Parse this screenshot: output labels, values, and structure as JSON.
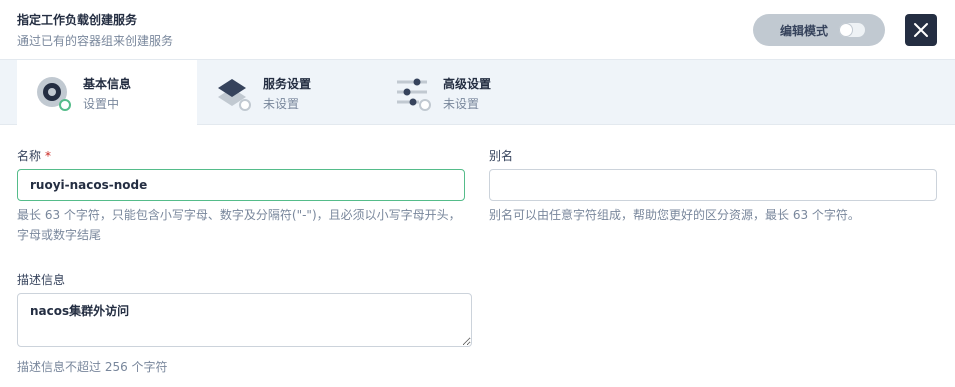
{
  "header": {
    "title": "指定工作负载创建服务",
    "subtitle": "通过已有的容器组来创建服务",
    "edit_mode_label": "编辑模式"
  },
  "tabs": [
    {
      "label": "基本信息",
      "status": "设置中"
    },
    {
      "label": "服务设置",
      "status": "未设置"
    },
    {
      "label": "高级设置",
      "status": "未设置"
    }
  ],
  "form": {
    "name": {
      "label": "名称",
      "required_mark": "*",
      "value": "ruoyi-nacos-node",
      "hint": "最长 63 个字符，只能包含小写字母、数字及分隔符(\"-\")，且必须以小写字母开头，字母或数字结尾"
    },
    "alias": {
      "label": "别名",
      "value": "",
      "hint": "别名可以由任意字符组成，帮助您更好的区分资源，最长 63 个字符。"
    },
    "description": {
      "label": "描述信息",
      "value": "nacos集群外访问",
      "hint": "描述信息不超过 256 个字符"
    }
  },
  "colors": {
    "accent": "#55bc8a",
    "dark": "#242e42",
    "muted": "#79879c",
    "required": "#ca2621"
  },
  "icons": {
    "close": "close-icon",
    "toggle": "toggle-icon",
    "tab_basic": "basic-info-icon",
    "tab_service": "service-settings-icon",
    "tab_advanced": "advanced-settings-icon"
  }
}
